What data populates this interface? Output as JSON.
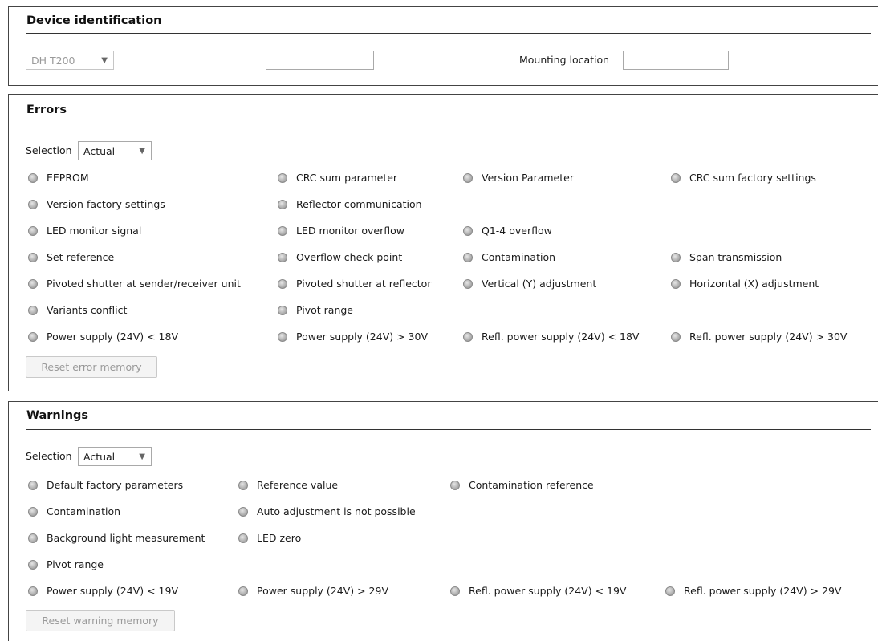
{
  "device": {
    "title": "Device identification",
    "device_select": "DH T200",
    "device_field": "",
    "mounting_label": "Mounting location",
    "mounting_value": ""
  },
  "errors": {
    "title": "Errors",
    "selection_label": "Selection",
    "selection_value": "Actual",
    "rows": [
      [
        "EEPROM",
        "CRC sum parameter",
        "Version Parameter",
        "CRC sum factory settings"
      ],
      [
        "Version factory settings",
        "Reflector communication",
        "",
        ""
      ],
      [
        "LED monitor signal",
        "LED monitor overflow",
        "Q1-4 overflow",
        ""
      ],
      [
        "Set reference",
        "Overflow check point",
        "Contamination",
        "Span transmission"
      ],
      [
        "Pivoted shutter at sender/receiver unit",
        "Pivoted shutter at reflector",
        "Vertical (Y) adjustment",
        "Horizontal (X) adjustment"
      ],
      [
        "Variants conflict",
        "Pivot range",
        "",
        ""
      ],
      [
        "Power supply (24V) < 18V",
        "Power supply (24V) > 30V",
        "Refl. power supply (24V) < 18V",
        "Refl. power supply (24V) > 30V"
      ]
    ],
    "reset_label": "Reset error memory"
  },
  "warnings": {
    "title": "Warnings",
    "selection_label": "Selection",
    "selection_value": "Actual",
    "rows": [
      [
        "Default factory parameters",
        "Reference value",
        "Contamination reference",
        ""
      ],
      [
        "Contamination",
        "Auto adjustment is not possible",
        "",
        ""
      ],
      [
        "Background light measurement",
        "LED zero",
        "",
        ""
      ],
      [
        "Pivot range",
        "",
        "",
        ""
      ],
      [
        "Power supply (24V) < 19V",
        "Power supply (24V) > 29V",
        "Refl. power supply (24V) < 19V",
        "Refl. power supply (24V) > 29V"
      ]
    ],
    "reset_label": "Reset warning memory"
  },
  "icons": {
    "indicator": "status-led-icon",
    "dropdown": "chevron-down-icon"
  },
  "colors": {
    "led_off": "#b3b3b3",
    "border": "#444444"
  }
}
